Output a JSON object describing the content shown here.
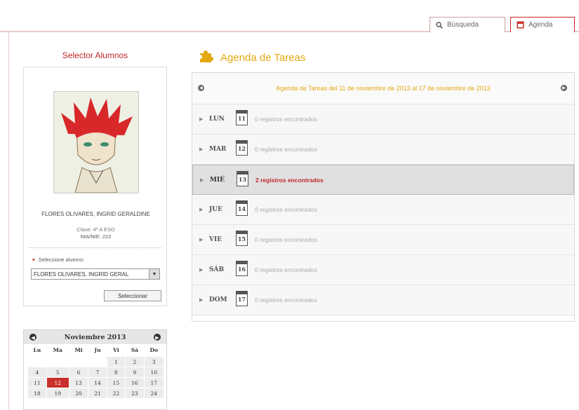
{
  "tabs": {
    "busqueda": "Búsqueda",
    "agenda": "Agenda"
  },
  "selector": {
    "title": "Selector Alumnos",
    "student_name": "FLORES OLIVARES, INGRID GERALDINE",
    "clase": "Clase: 4º A ESO",
    "nia": "NIA/NIE: 222",
    "select_label": "Seleccione alumno:",
    "select_value": "FLORES OLIVARES, INGRID GERAL",
    "button": "Seleccionar"
  },
  "calendar": {
    "month": "Noviembre 2013",
    "weekdays": [
      "Lu",
      "Ma",
      "Mi",
      "Ju",
      "Vi",
      "Sá",
      "Do"
    ],
    "weeks": [
      [
        "",
        "",
        "",
        "",
        "1",
        "2",
        "3"
      ],
      [
        "4",
        "5",
        "6",
        "7",
        "8",
        "9",
        "10"
      ],
      [
        "11",
        "12",
        "13",
        "14",
        "15",
        "16",
        "17"
      ],
      [
        "18",
        "19",
        "20",
        "21",
        "22",
        "23",
        "24"
      ]
    ],
    "today": "12"
  },
  "agenda": {
    "title": "Agenda de Tareas",
    "range": "Agenda de Tareas del 11 de noviembre de 2013 al 17 de noviembre de 2013",
    "days": [
      {
        "name": "LUN",
        "num": "11",
        "count": "0 registros encontrados",
        "active": false
      },
      {
        "name": "MAR",
        "num": "12",
        "count": "0 registros encontrados",
        "active": false
      },
      {
        "name": "MIÉ",
        "num": "13",
        "count": "2 registros encontrados",
        "active": true
      },
      {
        "name": "JUE",
        "num": "14",
        "count": "0 registros encontrados",
        "active": false
      },
      {
        "name": "VIE",
        "num": "15",
        "count": "0 registros encontrados",
        "active": false
      },
      {
        "name": "SÁB",
        "num": "16",
        "count": "0 registros encontrados",
        "active": false
      },
      {
        "name": "DOM",
        "num": "17",
        "count": "0 registros encontrados",
        "active": false
      }
    ]
  },
  "colors": {
    "accent_red": "#c0262a",
    "accent_yellow": "#e5a812"
  }
}
